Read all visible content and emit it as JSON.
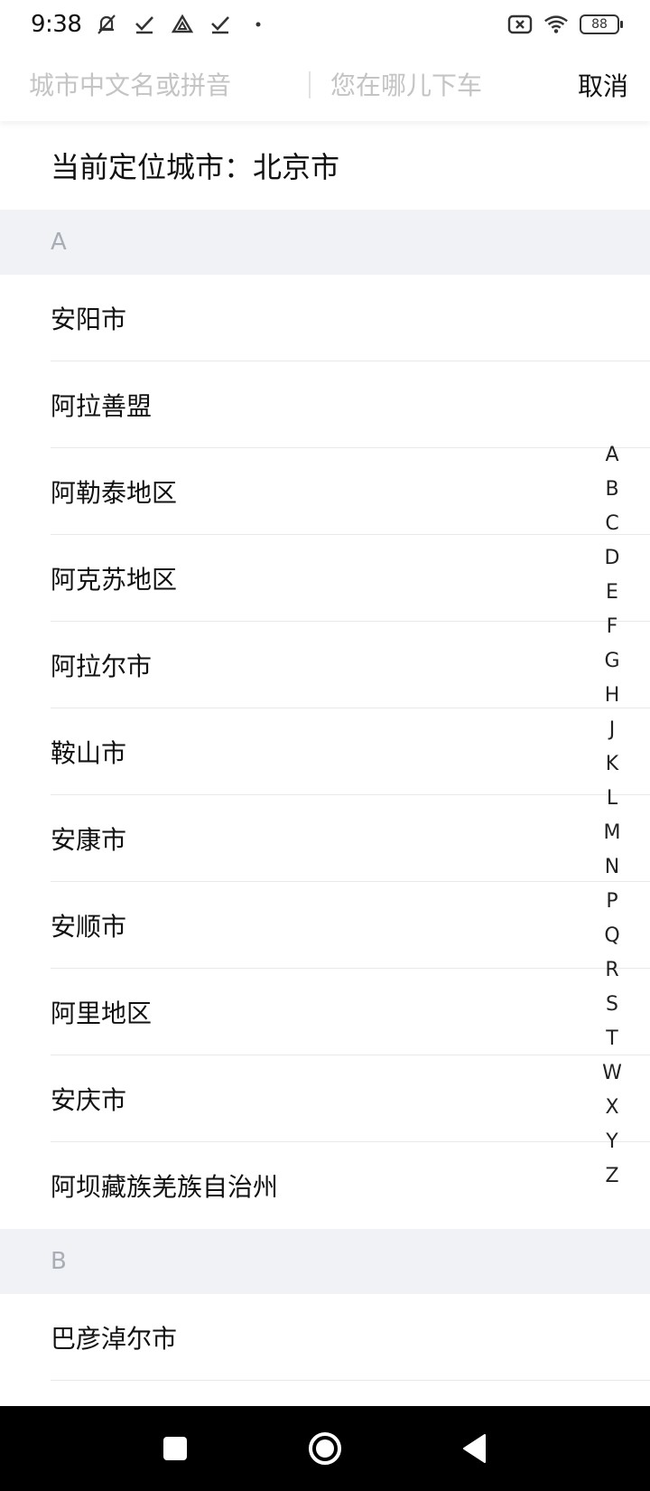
{
  "status_bar": {
    "time": "9:38",
    "battery_level": "88",
    "icons": [
      "notification-muted-icon",
      "check-icon",
      "drive-icon",
      "check-icon",
      "dot-icon",
      "sim-off-icon",
      "wifi-icon",
      "battery-icon"
    ]
  },
  "search": {
    "city_placeholder": "城市中文名或拼音",
    "destination_placeholder": "您在哪儿下车",
    "city_value": "",
    "destination_value": "",
    "cancel_label": "取消"
  },
  "current_location": {
    "text": "当前定位城市：北京市"
  },
  "sections": [
    {
      "letter": "A",
      "cities": [
        "安阳市",
        "阿拉善盟",
        "阿勒泰地区",
        "阿克苏地区",
        "阿拉尔市",
        "鞍山市",
        "安康市",
        "安顺市",
        "阿里地区",
        "安庆市",
        "阿坝藏族羌族自治州"
      ]
    },
    {
      "letter": "B",
      "cities": [
        "巴彦淖尔市"
      ]
    }
  ],
  "alphabet_index": [
    "A",
    "B",
    "C",
    "D",
    "E",
    "F",
    "G",
    "H",
    "J",
    "K",
    "L",
    "M",
    "N",
    "P",
    "Q",
    "R",
    "S",
    "T",
    "W",
    "X",
    "Y",
    "Z"
  ],
  "colors": {
    "section_bg": "#f1f2f6",
    "section_text": "#a9adb5",
    "divider": "#e9e9ec",
    "placeholder": "#c4c4c4",
    "nav_bg": "#000000"
  }
}
